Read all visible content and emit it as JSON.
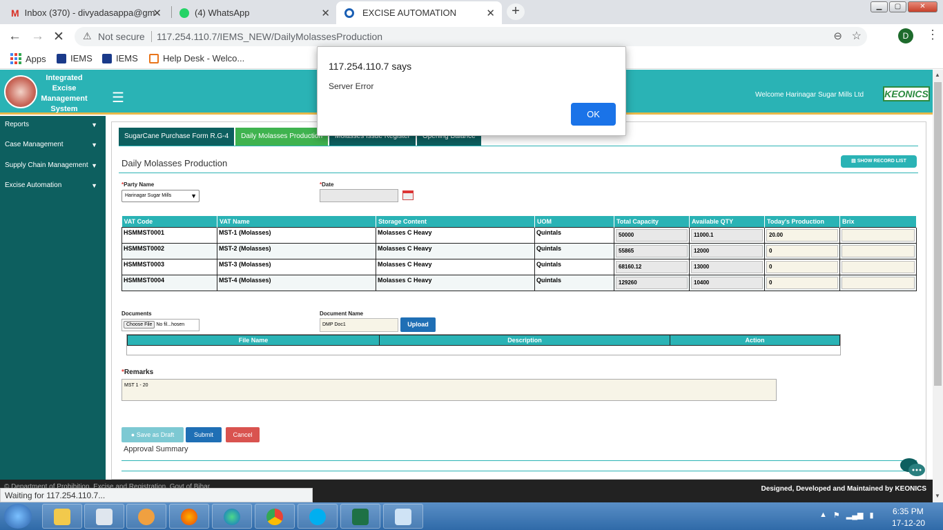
{
  "browser": {
    "tabs": [
      {
        "title": "Inbox (370) - divyadasappa@gm",
        "icon": "gmail-icon"
      },
      {
        "title": "(4) WhatsApp",
        "icon": "whatsapp-icon"
      },
      {
        "title": "EXCISE AUTOMATION",
        "icon": "loading-icon"
      }
    ],
    "new_tab": "+",
    "security": "Not secure",
    "url": "117.254.110.7/IEMS_NEW/DailyMolassesProduction",
    "profile_initial": "D",
    "bookmarks": [
      "Apps",
      "IEMS",
      "IEMS",
      "Help Desk - Welco..."
    ],
    "status": "Waiting for 117.254.110.7..."
  },
  "header": {
    "logo_text": "Integrated Excise Management System",
    "welcome": "Welcome Harinagar Sugar Mills Ltd",
    "partner_logo": "KEONICS"
  },
  "sidebar": {
    "items": [
      {
        "label": "Reports"
      },
      {
        "label": "Case Management"
      },
      {
        "label": "Supply Chain Management"
      },
      {
        "label": "Excise Automation"
      }
    ]
  },
  "form": {
    "tabs": [
      {
        "label": "SugarCane Purchase Form R.G-4",
        "active": false
      },
      {
        "label": "Daily Molasses Production",
        "active": true
      },
      {
        "label": "Molasses Issue Register",
        "active": false
      },
      {
        "label": "Opening Balance",
        "active": false
      }
    ],
    "title": "Daily Molasses Production",
    "show_record_list": "SHOW RECORD LIST",
    "party_label": "Party Name",
    "party_value": "Harinagar Sugar Mills",
    "date_label": "Date",
    "date_value": "",
    "table": {
      "headers": [
        "VAT Code",
        "VAT Name",
        "Storage Content",
        "UOM",
        "Total Capacity",
        "Available QTY",
        "Today's Production",
        "Brix"
      ],
      "rows": [
        {
          "code": "HSMMST0001",
          "name": "MST-1 (Molasses)",
          "storage": "Molasses C Heavy",
          "uom": "Quintals",
          "capacity": "50000",
          "available": "11000.1",
          "production": "20.00",
          "brix": ""
        },
        {
          "code": "HSMMST0002",
          "name": "MST-2 (Molasses)",
          "storage": "Molasses C Heavy",
          "uom": "Quintals",
          "capacity": "55865",
          "available": "12000",
          "production": "0",
          "brix": ""
        },
        {
          "code": "HSMMST0003",
          "name": "MST-3 (Molasses)",
          "storage": "Molasses C Heavy",
          "uom": "Quintals",
          "capacity": "68160.12",
          "available": "13000",
          "production": "0",
          "brix": ""
        },
        {
          "code": "HSMMST0004",
          "name": "MST-4 (Molasses)",
          "storage": "Molasses C Heavy",
          "uom": "Quintals",
          "capacity": "129260",
          "available": "10400",
          "production": "0",
          "brix": ""
        }
      ]
    },
    "documents_label": "Documents",
    "choose_file": "Choose File",
    "file_status": "No fil...hosen",
    "doc_name_label": "Document Name",
    "doc_name_value": "DMP Doc1",
    "upload": "Upload",
    "doc_table_headers": [
      "File Name",
      "Description",
      "Action"
    ],
    "remarks_label": "Remarks",
    "remarks_value": "MST 1 - 20",
    "save_draft": "Save as Draft",
    "submit": "Submit",
    "cancel": "Cancel",
    "approval_summary": "Approval Summary"
  },
  "footer": {
    "left": "© Department of Prohibition, Excise and Registration, Govt of Bihar",
    "right": "Designed, Developed and Maintained by KEONICS"
  },
  "alert": {
    "title": "117.254.110.7 says",
    "message": "Server Error",
    "ok": "OK"
  },
  "taskbar": {
    "time": "6:35 PM",
    "date": "17-12-20",
    "apps": [
      "file-explorer-icon",
      "media-center-icon",
      "media-player-icon",
      "firefox-icon",
      "edge-icon",
      "chrome-icon",
      "skype-icon",
      "excel-icon",
      "paint-icon"
    ]
  }
}
